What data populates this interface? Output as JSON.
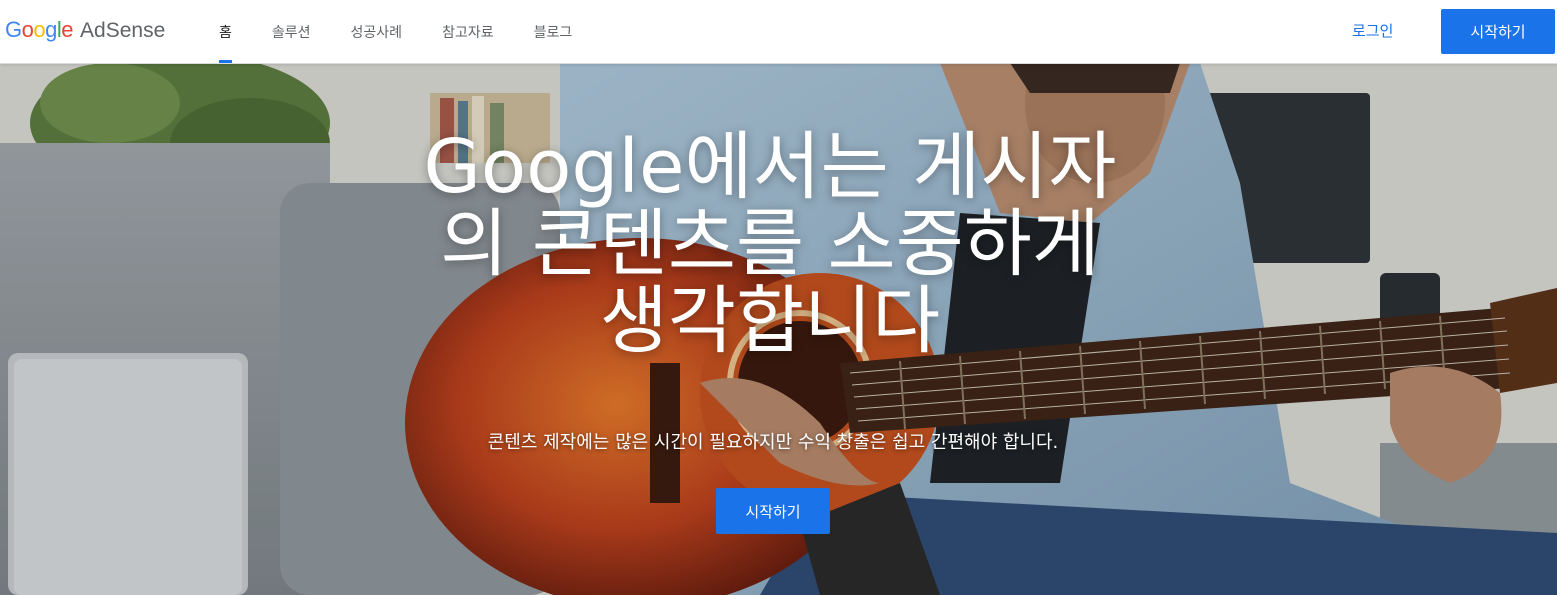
{
  "header": {
    "logo": {
      "google": [
        "G",
        "o",
        "o",
        "g",
        "l",
        "e"
      ],
      "product": "AdSense"
    },
    "nav": [
      {
        "label": "홈",
        "active": true
      },
      {
        "label": "솔루션",
        "active": false
      },
      {
        "label": "성공사례",
        "active": false
      },
      {
        "label": "참고자료",
        "active": false
      },
      {
        "label": "블로그",
        "active": false
      }
    ],
    "login_label": "로그인",
    "start_label": "시작하기"
  },
  "hero": {
    "title_line1": "Google에서는 게시자",
    "title_line2": "의 콘텐츠를 소중하게",
    "title_line3": "생각합니다",
    "subtitle": "콘텐츠 제작에는 많은 시간이 필요하지만 수익 창출은 쉽고 간편해야 합니다.",
    "cta_label": "시작하기"
  },
  "colors": {
    "accent": "#1a73e8",
    "google_blue": "#4285f4",
    "google_red": "#ea4335",
    "google_yellow": "#fbbc05",
    "google_green": "#34a853"
  }
}
